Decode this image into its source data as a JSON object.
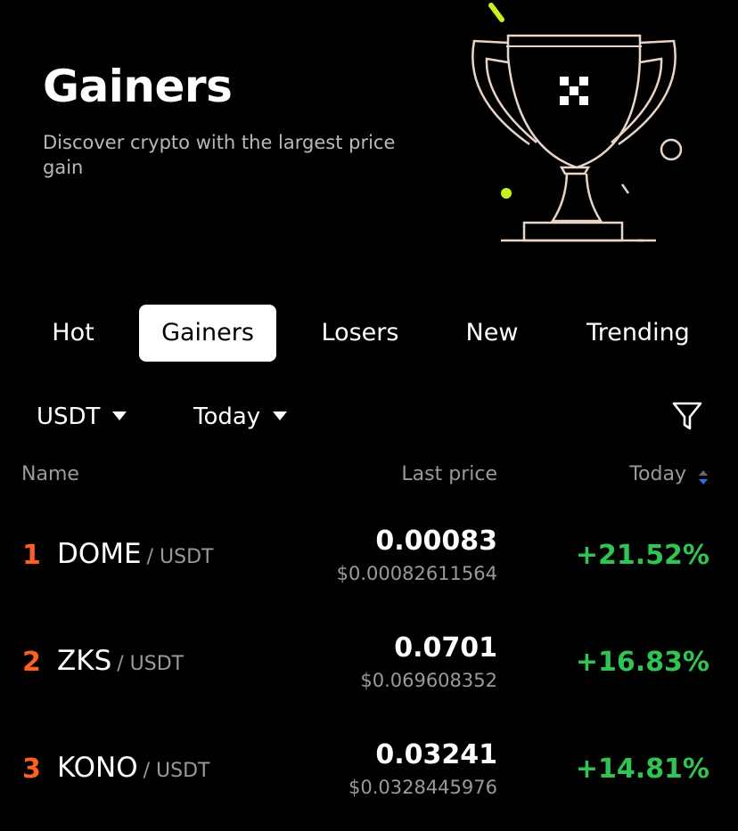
{
  "hero": {
    "title": "Gainers",
    "subtitle": "Discover crypto with the largest price gain",
    "illustration": "trophy-icon",
    "accent": "#c8f01e",
    "outline": "#e9d5c8"
  },
  "tabs": [
    {
      "label": "Hot"
    },
    {
      "label": "Gainers",
      "active": true
    },
    {
      "label": "Losers"
    },
    {
      "label": "New"
    },
    {
      "label": "Trending"
    }
  ],
  "filters": {
    "quote_currency": "USDT",
    "period": "Today",
    "filter_icon": "filter-icon"
  },
  "columns": {
    "name": "Name",
    "last_price": "Last price",
    "change": "Today",
    "sort_icon": "sort-arrows-icon"
  },
  "rows": [
    {
      "rank": "1",
      "symbol": "DOME",
      "quote": "/ USDT",
      "price": "0.00083",
      "fiat": "$0.00082611564",
      "change": "+21.52%"
    },
    {
      "rank": "2",
      "symbol": "ZKS",
      "quote": "/ USDT",
      "price": "0.0701",
      "fiat": "$0.069608352",
      "change": "+16.83%"
    },
    {
      "rank": "3",
      "symbol": "KONO",
      "quote": "/ USDT",
      "price": "0.03241",
      "fiat": "$0.0328445976",
      "change": "+14.81%"
    }
  ],
  "colors": {
    "background": "#000000",
    "rank": "#ff5f1f",
    "positive": "#2fc552",
    "muted": "#9a9a9a",
    "sort_active": "#2f6fe8"
  }
}
